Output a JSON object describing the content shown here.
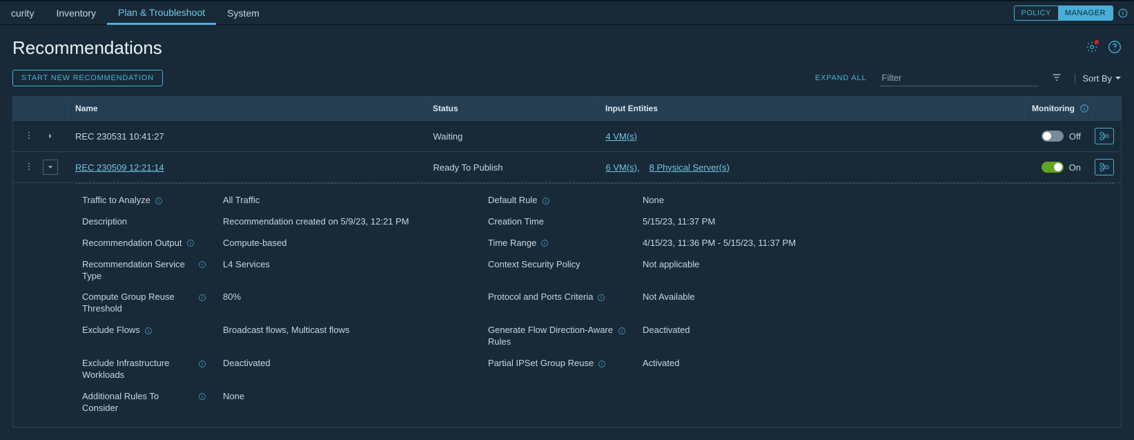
{
  "nav": {
    "tabs": [
      "curity",
      "Inventory",
      "Plan & Troubleshoot",
      "System"
    ],
    "activeIndex": 2,
    "policy": "POLICY",
    "manager": "MANAGER",
    "segActive": "manager"
  },
  "page": {
    "title": "Recommendations"
  },
  "toolbar": {
    "start": "START NEW RECOMMENDATION",
    "expandAll": "EXPAND ALL",
    "filterPlaceholder": "Filter",
    "sortBy": "Sort By"
  },
  "table": {
    "headers": {
      "name": "Name",
      "status": "Status",
      "input": "Input Entities",
      "monitoring": "Monitoring"
    },
    "rows": [
      {
        "expanded": false,
        "name": "REC 230531 10:41:27",
        "nameLink": false,
        "status": "Waiting",
        "inputEntities": [
          {
            "text": "4 VM(s)",
            "link": true
          }
        ],
        "monitoring": {
          "on": false,
          "label": "Off"
        }
      },
      {
        "expanded": true,
        "name": "REC 230509 12:21:14",
        "nameLink": true,
        "status": "Ready To Publish",
        "inputEntities": [
          {
            "text": "6 VM(s),",
            "link": true
          },
          {
            "text": "8 Physical Server(s)",
            "link": true
          }
        ],
        "monitoring": {
          "on": true,
          "label": "On"
        },
        "details": {
          "left": [
            {
              "label": "Traffic to Analyze",
              "info": true,
              "value": "All Traffic"
            },
            {
              "label": "Description",
              "info": false,
              "value": "Recommendation created on 5/9/23, 12:21 PM"
            },
            {
              "label": "Recommendation Output",
              "info": true,
              "value": "Compute-based"
            },
            {
              "label": "Recommendation Service Type",
              "info": true,
              "value": "L4 Services"
            },
            {
              "label": "Compute Group Reuse Threshold",
              "info": true,
              "value": "80%"
            },
            {
              "label": "Exclude Flows",
              "info": true,
              "value": "Broadcast flows, Multicast flows"
            },
            {
              "label": "Exclude Infrastructure Workloads",
              "info": true,
              "value": "Deactivated"
            },
            {
              "label": "Additional Rules To Consider",
              "info": true,
              "value": "None"
            }
          ],
          "right": [
            {
              "label": "Default Rule",
              "info": true,
              "value": "None"
            },
            {
              "label": "Creation Time",
              "info": false,
              "value": "5/15/23, 11:37 PM"
            },
            {
              "label": "Time Range",
              "info": true,
              "value": "4/15/23, 11:36 PM - 5/15/23, 11:37 PM"
            },
            {
              "label": "Context Security Policy",
              "info": false,
              "value": "Not applicable"
            },
            {
              "label": "Protocol and Ports Criteria",
              "info": true,
              "value": "Not Available"
            },
            {
              "label": "Generate Flow Direction-Aware Rules",
              "info": true,
              "value": "Deactivated"
            },
            {
              "label": "Partial IPSet Group Reuse",
              "info": true,
              "value": "Activated"
            }
          ]
        }
      }
    ]
  }
}
